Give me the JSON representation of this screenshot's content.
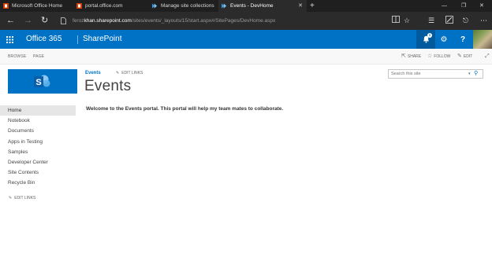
{
  "browser": {
    "tabs": [
      {
        "title": "Microsoft Office Home",
        "icon": "office-icon",
        "active": false
      },
      {
        "title": "portal.office.com",
        "icon": "office-icon",
        "active": false
      },
      {
        "title": "Manage site collections",
        "icon": "sharepoint-icon",
        "active": false
      },
      {
        "title": "Events - DevHome",
        "icon": "sharepoint-icon",
        "active": true
      }
    ],
    "new_tab_glyph": "+",
    "url_prefix": "feroz",
    "url_host": "khan.sharepoint.com",
    "url_path": "/sites/events/_layouts/15/start.aspx#/SitePages/DevHome.aspx"
  },
  "suite": {
    "brand": "Office 365",
    "app": "SharePoint",
    "notification_count": "1",
    "color": "#0072c6"
  },
  "ribbon": {
    "tabs": [
      "BROWSE",
      "PAGE"
    ],
    "actions": [
      {
        "label": "SHARE",
        "icon": "share-icon"
      },
      {
        "label": "FOLLOW",
        "icon": "star-icon"
      },
      {
        "label": "EDIT",
        "icon": "pencil-icon"
      }
    ]
  },
  "site": {
    "breadcrumb": "Events",
    "edit_links": "EDIT LINKS",
    "title": "Events",
    "search_placeholder": "Search this site"
  },
  "quick_launch": {
    "items": [
      "Home",
      "Notebook",
      "Documents",
      "Apps in Testing",
      "Samples",
      "Developer Center",
      "Site Contents",
      "Recycle Bin"
    ],
    "edit_links": "EDIT LINKS"
  },
  "content": {
    "welcome": "Welcome to the Events portal. This portal will help my team mates to collaborate."
  }
}
